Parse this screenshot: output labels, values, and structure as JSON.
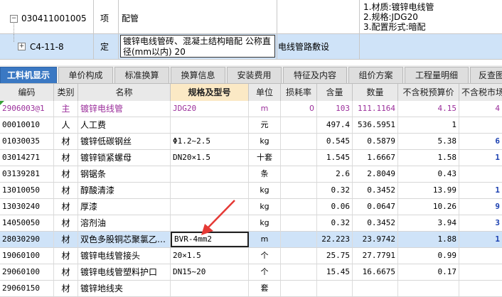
{
  "bill": {
    "row1": {
      "toggle": "−",
      "code": "030411001005",
      "type": "项",
      "name": "配管",
      "features": [
        "1.材质:镀锌电线管",
        "2.规格:JDG20",
        "3.配置形式:暗配"
      ]
    },
    "row2": {
      "toggle": "+",
      "code": "C4-11-8",
      "type": "定",
      "name": "镀锌电线管砖、混凝土结构暗配 公称直径(mm以内) 20",
      "work": "电线管路敷设"
    }
  },
  "tabs": [
    {
      "label": "工料机显示",
      "active": true
    },
    {
      "label": "单价构成",
      "active": false
    },
    {
      "label": "标准换算",
      "active": false
    },
    {
      "label": "换算信息",
      "active": false
    },
    {
      "label": "安装费用",
      "active": false
    },
    {
      "label": "特征及内容",
      "active": false
    },
    {
      "label": "组价方案",
      "active": false
    },
    {
      "label": "工程量明细",
      "active": false
    },
    {
      "label": "反查图",
      "active": false
    }
  ],
  "grid": {
    "headers": {
      "code": "编码",
      "cat": "类别",
      "name": "名称",
      "spec": "规格及型号",
      "unit": "单位",
      "loss": "损耗率",
      "qty": "含量",
      "num": "数量",
      "price": "不含税预算价",
      "mkt": "不含税市场"
    },
    "rows": [
      {
        "code": "2906003@1",
        "cat": "主",
        "name": "镀锌电线管",
        "spec": "JDG20",
        "unit": "m",
        "loss": "0",
        "qty": "103",
        "num": "111.1164",
        "price": "4.15",
        "mkt": "4",
        "style": "main"
      },
      {
        "code": "00010010",
        "cat": "人",
        "name": "人工费",
        "spec": "",
        "unit": "元",
        "loss": "",
        "qty": "497.4",
        "num": "536.5951",
        "price": "1",
        "mkt": "",
        "style": "normal"
      },
      {
        "code": "01030035",
        "cat": "材",
        "name": "镀锌低碳钢丝",
        "spec": "Φ1.2~2.5",
        "unit": "kg",
        "loss": "",
        "qty": "0.545",
        "num": "0.5879",
        "price": "5.38",
        "mkt": "6",
        "style": "normal"
      },
      {
        "code": "03014271",
        "cat": "材",
        "name": "镀锌锁紧螺母",
        "spec": "DN20×1.5",
        "unit": "十套",
        "loss": "",
        "qty": "1.545",
        "num": "1.6667",
        "price": "1.58",
        "mkt": "1",
        "style": "normal"
      },
      {
        "code": "03139281",
        "cat": "材",
        "name": "钢锯条",
        "spec": "",
        "unit": "条",
        "loss": "",
        "qty": "2.6",
        "num": "2.8049",
        "price": "0.43",
        "mkt": "",
        "style": "normal"
      },
      {
        "code": "13010050",
        "cat": "材",
        "name": "醇酸清漆",
        "spec": "",
        "unit": "kg",
        "loss": "",
        "qty": "0.32",
        "num": "0.3452",
        "price": "13.99",
        "mkt": "1",
        "style": "normal"
      },
      {
        "code": "13030240",
        "cat": "材",
        "name": "厚漆",
        "spec": "",
        "unit": "kg",
        "loss": "",
        "qty": "0.06",
        "num": "0.0647",
        "price": "10.26",
        "mkt": "9",
        "style": "normal"
      },
      {
        "code": "14050050",
        "cat": "材",
        "name": "溶剂油",
        "spec": "",
        "unit": "kg",
        "loss": "",
        "qty": "0.32",
        "num": "0.3452",
        "price": "3.94",
        "mkt": "3",
        "style": "normal"
      },
      {
        "code": "28030290",
        "cat": "材",
        "name": "双色多股铜芯聚氯乙…",
        "spec": "BVR-4mm2",
        "unit": "m",
        "loss": "",
        "qty": "22.223",
        "num": "23.9742",
        "price": "1.88",
        "mkt": "1",
        "style": "sel"
      },
      {
        "code": "19060100",
        "cat": "材",
        "name": "镀锌电线管接头",
        "spec": "20×1.5",
        "unit": "个",
        "loss": "",
        "qty": "25.75",
        "num": "27.7791",
        "price": "0.99",
        "mkt": "",
        "style": "normal"
      },
      {
        "code": "29060100",
        "cat": "材",
        "name": "镀锌电线管塑料护口",
        "spec": "DN15~20",
        "unit": "个",
        "loss": "",
        "qty": "15.45",
        "num": "16.6675",
        "price": "0.17",
        "mkt": "",
        "style": "normal"
      },
      {
        "code": "29060150",
        "cat": "材",
        "name": "镀锌地线夹",
        "spec": "",
        "unit": "套",
        "loss": "",
        "qty": "",
        "num": "",
        "price": "",
        "mkt": "",
        "style": "normal"
      }
    ]
  },
  "colors": {
    "selected_row": "#cfe3f8",
    "main_material": "#9b2f9b",
    "active_tab": "#3a78c3",
    "arrow": "#e53935"
  }
}
